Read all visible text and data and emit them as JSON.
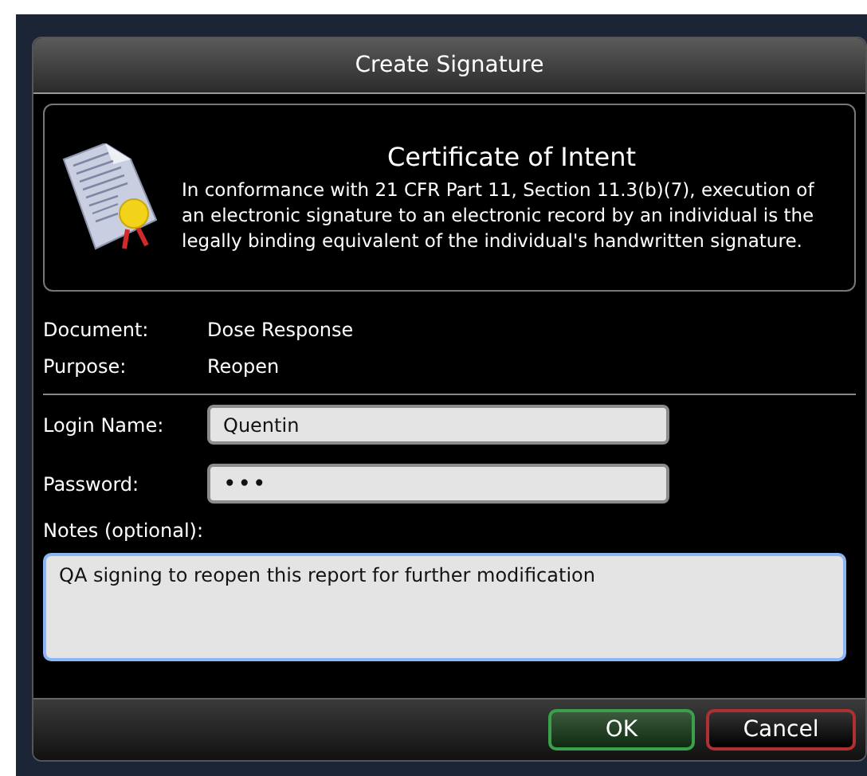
{
  "window": {
    "title": "Create Signature"
  },
  "certificate": {
    "title": "Certificate of Intent",
    "text": "In conformance with 21 CFR Part 11, Section 11.3(b)(7), execution of an electronic signature to an electronic record by an individual is the legally binding equivalent of the individual's handwritten signature."
  },
  "info": [
    {
      "label": "Document:",
      "value": "Dose Response"
    },
    {
      "label": "Purpose:",
      "value": "Reopen"
    }
  ],
  "fields": [
    {
      "label": "Login Name:",
      "value": "Quentin"
    },
    {
      "label": "Password:",
      "value": "•••"
    }
  ],
  "notes": {
    "label": "Notes (optional):",
    "value": "QA signing to reopen this report for further modification"
  },
  "buttons": [
    {
      "label": "OK",
      "kind": "ok"
    },
    {
      "label": "Cancel",
      "kind": "cancel"
    }
  ]
}
